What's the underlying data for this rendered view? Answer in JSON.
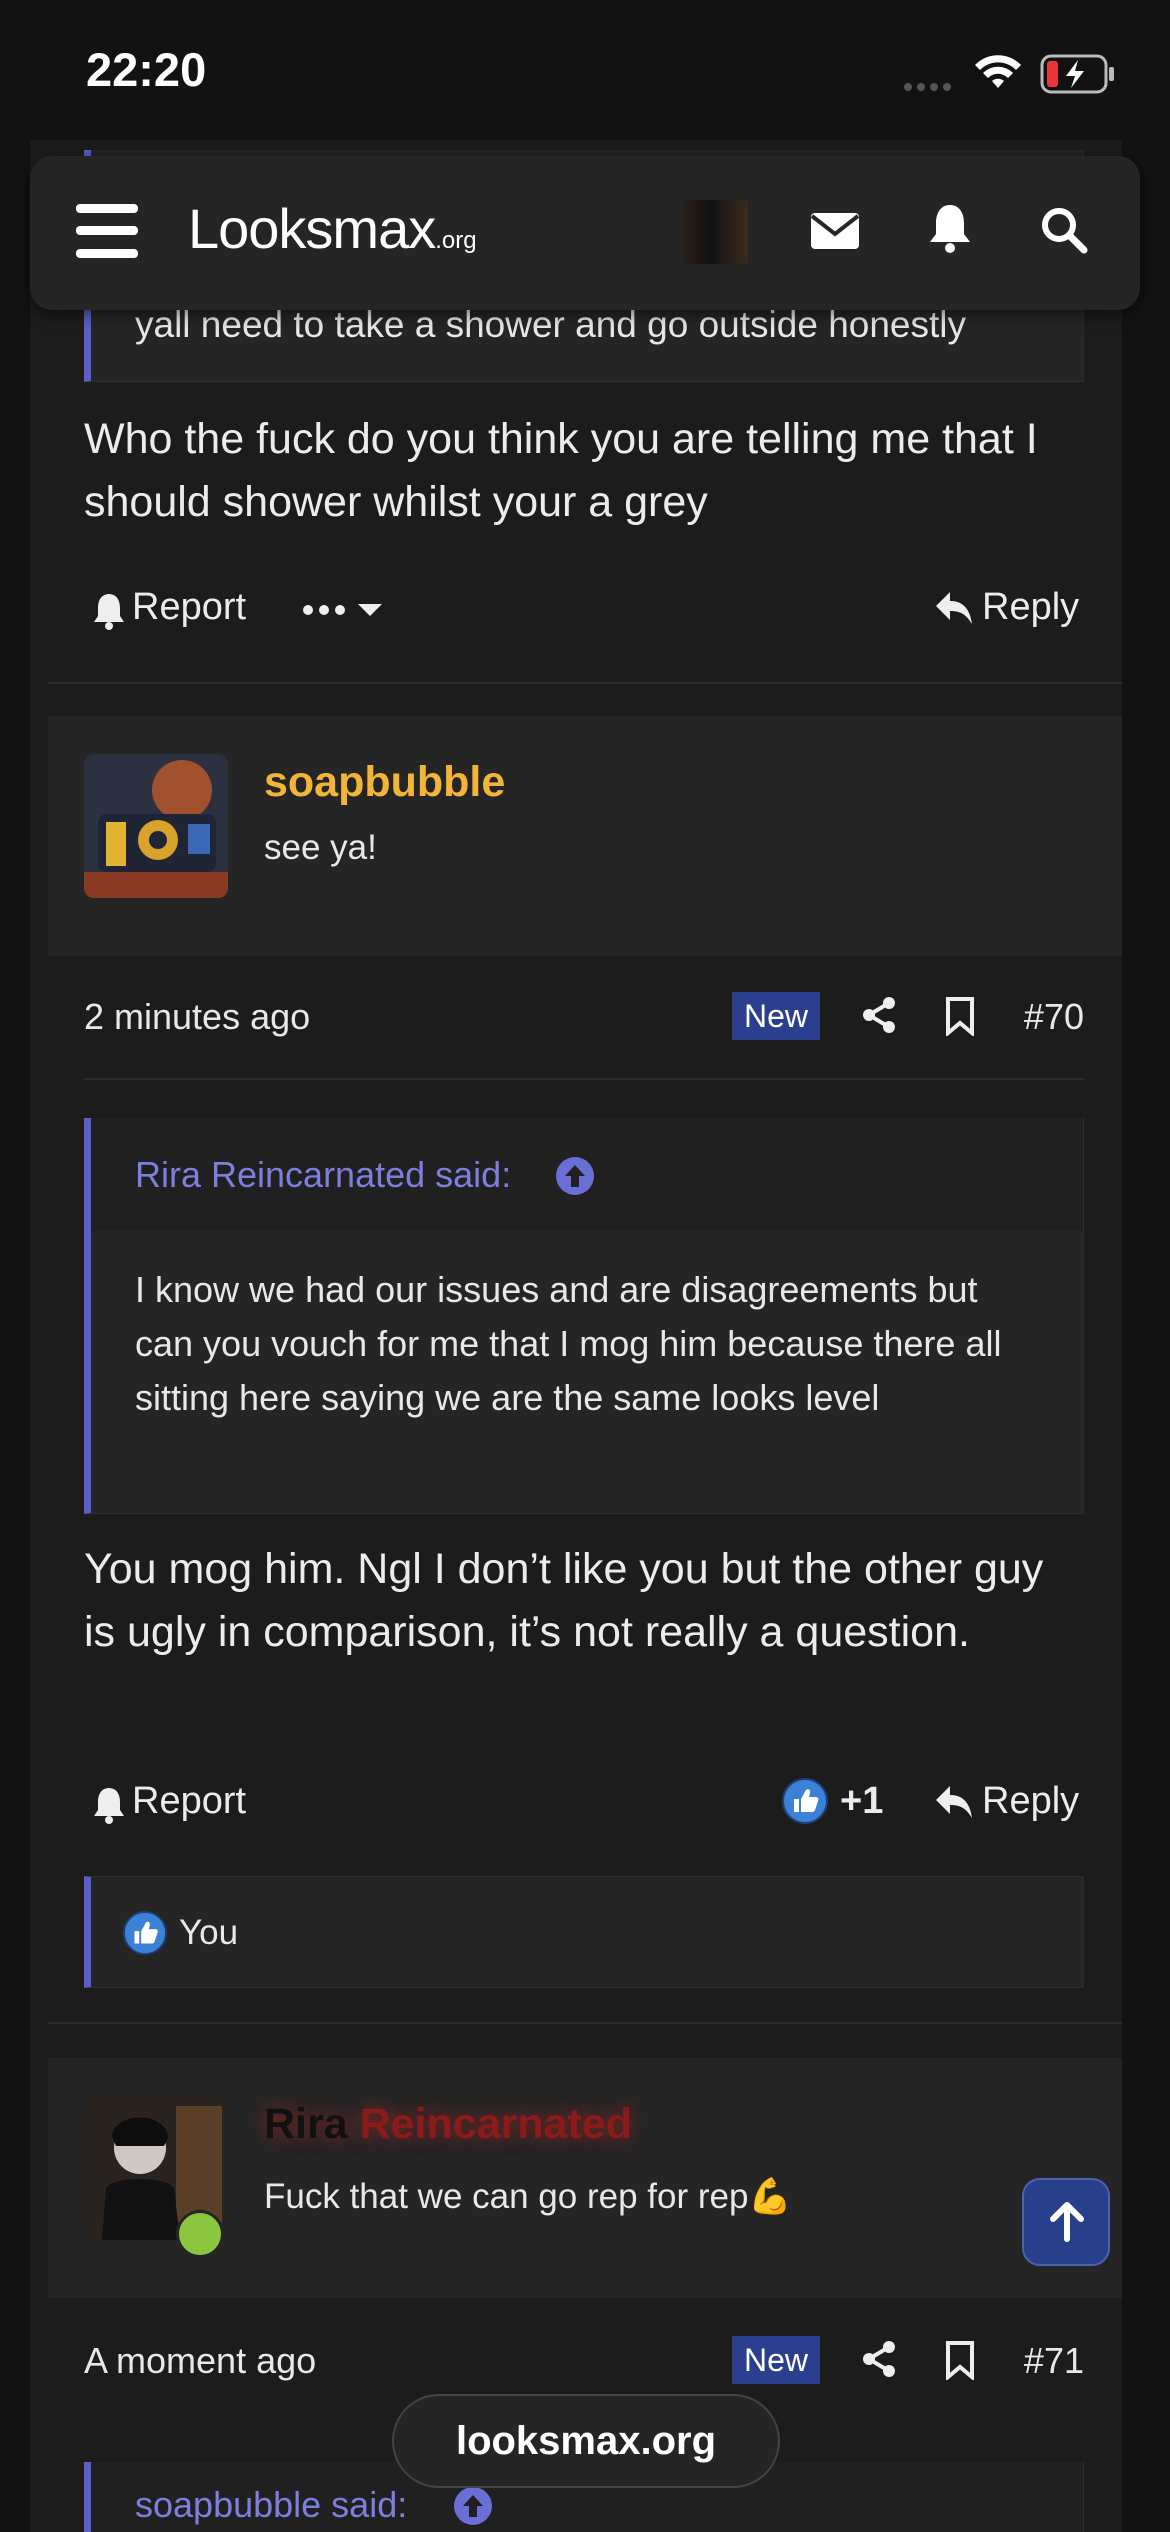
{
  "status_bar": {
    "time": "22:20"
  },
  "nav": {
    "logo": "Looksmax",
    "logo_suffix": ".org"
  },
  "post_prev": {
    "quote_text": "yall need to take a shower and go outside honestly",
    "body": "Who the fuck do you think you are telling me that I should shower whilst your a grey",
    "report": "Report",
    "reply": "Reply"
  },
  "post_70": {
    "username": "soapbubble",
    "username_color": "#f2b53a",
    "user_title": "see ya!",
    "time": "2 minutes ago",
    "badge": "New",
    "number": "#70",
    "quote_author": "Rira Reincarnated said:",
    "quote_text": "I know we had our issues and are disagreements but can you vouch for me that I mog him because there all sitting here saying we are the same looks level",
    "body": "You mog him. Ngl I don’t like you but the other guy is ugly in comparison, it’s not really a question.",
    "report": "Report",
    "like_count": "+1",
    "reply": "Reply",
    "reaction_user": "You"
  },
  "post_71": {
    "username_first": "Rira",
    "username_second": "Reincarnated",
    "user_title": "Fuck that we can go rep for rep💪",
    "time": "A moment ago",
    "badge": "New",
    "number": "#71",
    "quote_author": "soapbubble said:"
  },
  "browser": {
    "url": "looksmax.org"
  },
  "colors": {
    "accent": "#5b5fc7",
    "link": "#7b7fdd",
    "badge_bg": "#2b3f8e",
    "online": "#8cc63f"
  }
}
